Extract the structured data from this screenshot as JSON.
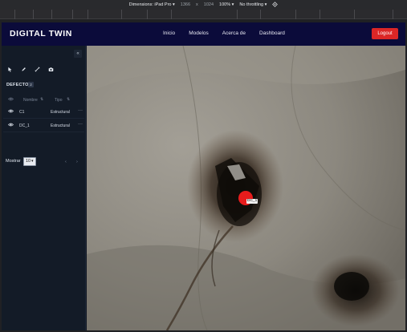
{
  "devtools": {
    "dimensions_label": "Dimensions: iPad Pro",
    "width": "1366",
    "times": "x",
    "height": "1024",
    "zoom": "100%",
    "throttling": "No throttling"
  },
  "nav": {
    "brand": "DIGITAL TWIN",
    "links": [
      "Inicio",
      "Modelos",
      "Acerca de",
      "Dashboard"
    ],
    "logout": "Logout"
  },
  "sidebar": {
    "collapse": "«",
    "tools": [
      "cursor-icon",
      "pencil-icon",
      "measure-icon",
      "camera-icon"
    ],
    "panel_title": "DEFECTOS",
    "count": "2",
    "columns": {
      "name": "Nombre",
      "type": "Tipo",
      "sort": "⇅"
    },
    "rows": [
      {
        "name": "C1",
        "type": "Estructural"
      },
      {
        "name": "DC_1",
        "type": "Estructural"
      }
    ],
    "more": "···",
    "show_label": "Mostrar",
    "show_value": "10",
    "prev": "‹",
    "next": "›"
  },
  "viewer": {
    "marker_label": "DC_1"
  }
}
